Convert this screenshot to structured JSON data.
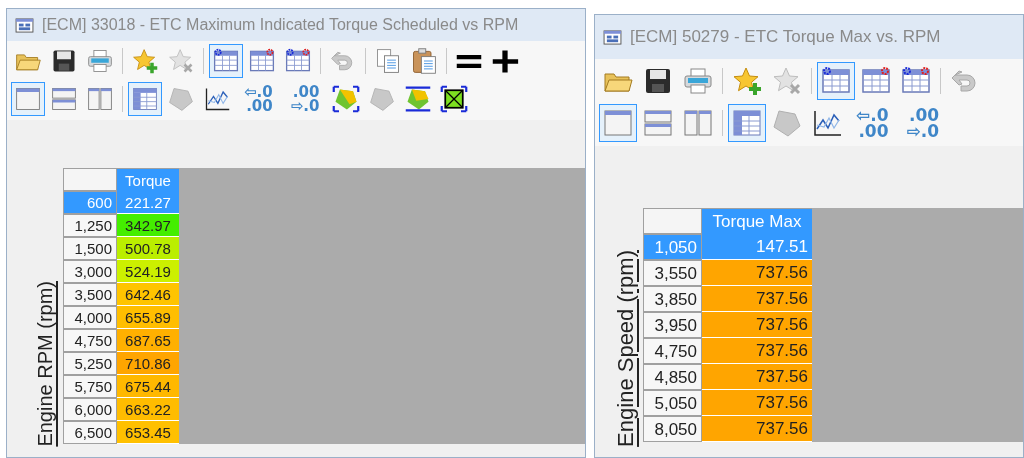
{
  "windows": [
    {
      "title": "[ECM] 33018 - ETC Maximum Indicated Torque Scheduled vs RPM",
      "toolbars": [
        [
          {
            "kind": "open",
            "selected": false
          },
          {
            "kind": "save",
            "selected": false
          },
          {
            "kind": "print",
            "selected": false
          },
          {
            "kind": "separator"
          },
          {
            "kind": "favorite-add",
            "selected": false
          },
          {
            "kind": "favorite-remove",
            "selected": false
          },
          {
            "kind": "separator"
          },
          {
            "kind": "table-x",
            "selected": true
          },
          {
            "kind": "table-y",
            "selected": false
          },
          {
            "kind": "table-xy",
            "selected": false
          },
          {
            "kind": "separator"
          },
          {
            "kind": "undo",
            "selected": false
          },
          {
            "kind": "separator"
          },
          {
            "kind": "copy",
            "selected": false
          },
          {
            "kind": "paste",
            "selected": false
          },
          {
            "kind": "separator"
          },
          {
            "kind": "equals",
            "selected": false
          },
          {
            "kind": "plus",
            "selected": false
          }
        ],
        [
          {
            "kind": "view-single",
            "selected": true
          },
          {
            "kind": "view-rows",
            "selected": false
          },
          {
            "kind": "view-columns",
            "selected": false
          },
          {
            "kind": "separator"
          },
          {
            "kind": "table-view",
            "selected": true
          },
          {
            "kind": "surface",
            "selected": false
          },
          {
            "kind": "graph",
            "selected": false
          },
          {
            "kind": "decimals",
            "lines": [
              "⇦.0",
              ".00"
            ]
          },
          {
            "kind": "decimals",
            "lines": [
              ".00",
              "⇨.0"
            ]
          },
          {
            "kind": "surface-fit",
            "selected": false
          },
          {
            "kind": "surface-side",
            "selected": false
          },
          {
            "kind": "surface-flat",
            "selected": false
          },
          {
            "kind": "surface-box",
            "selected": false
          }
        ]
      ],
      "axis_label": "Engine RPM (rpm)",
      "column_header": "Torque",
      "rows": [
        {
          "axis": "600",
          "value": "221.27",
          "selected": true,
          "color": "#3399ff"
        },
        {
          "axis": "1,250",
          "value": "342.97",
          "selected": false,
          "color": "#44ee00"
        },
        {
          "axis": "1,500",
          "value": "500.78",
          "selected": false,
          "color": "#bbee00"
        },
        {
          "axis": "3,000",
          "value": "524.19",
          "selected": false,
          "color": "#ccf000"
        },
        {
          "axis": "3,500",
          "value": "642.46",
          "selected": false,
          "color": "#ffc400"
        },
        {
          "axis": "4,000",
          "value": "655.89",
          "selected": false,
          "color": "#ffbe00"
        },
        {
          "axis": "4,750",
          "value": "687.65",
          "selected": false,
          "color": "#ffb000"
        },
        {
          "axis": "5,250",
          "value": "710.86",
          "selected": false,
          "color": "#ffa500"
        },
        {
          "axis": "5,750",
          "value": "675.44",
          "selected": false,
          "color": "#ffb800"
        },
        {
          "axis": "6,000",
          "value": "663.22",
          "selected": false,
          "color": "#ffbc00"
        },
        {
          "axis": "6,500",
          "value": "653.45",
          "selected": false,
          "color": "#ffc000"
        }
      ]
    },
    {
      "title": "[ECM] 50279 - ETC Torque Max vs. RPM",
      "toolbars": [
        [
          {
            "kind": "open",
            "selected": false
          },
          {
            "kind": "save",
            "selected": false
          },
          {
            "kind": "print",
            "selected": false
          },
          {
            "kind": "separator"
          },
          {
            "kind": "favorite-add",
            "selected": false
          },
          {
            "kind": "favorite-remove",
            "selected": false
          },
          {
            "kind": "separator"
          },
          {
            "kind": "table-x",
            "selected": true
          },
          {
            "kind": "table-y",
            "selected": false
          },
          {
            "kind": "table-xy",
            "selected": false
          },
          {
            "kind": "separator"
          },
          {
            "kind": "undo",
            "selected": false
          }
        ],
        [
          {
            "kind": "view-single",
            "selected": true
          },
          {
            "kind": "view-rows",
            "selected": false
          },
          {
            "kind": "view-columns",
            "selected": false
          },
          {
            "kind": "separator"
          },
          {
            "kind": "table-view",
            "selected": true
          },
          {
            "kind": "surface",
            "selected": false
          },
          {
            "kind": "graph",
            "selected": false
          },
          {
            "kind": "decimals",
            "lines": [
              "⇦.0",
              ".00"
            ]
          },
          {
            "kind": "decimals",
            "lines": [
              ".00",
              "⇨.0"
            ]
          }
        ]
      ],
      "axis_label": "Engine Speed (rpm)",
      "column_header": "Torque Max",
      "rows": [
        {
          "axis": "1,050",
          "value": "147.51",
          "selected": true,
          "color": "#3399ff"
        },
        {
          "axis": "3,550",
          "value": "737.56",
          "selected": false,
          "color": "#ffa500"
        },
        {
          "axis": "3,850",
          "value": "737.56",
          "selected": false,
          "color": "#ffa500"
        },
        {
          "axis": "3,950",
          "value": "737.56",
          "selected": false,
          "color": "#ffa500"
        },
        {
          "axis": "4,750",
          "value": "737.56",
          "selected": false,
          "color": "#ffa500"
        },
        {
          "axis": "4,850",
          "value": "737.56",
          "selected": false,
          "color": "#ffa500"
        },
        {
          "axis": "5,050",
          "value": "737.56",
          "selected": false,
          "color": "#ffa500"
        },
        {
          "axis": "8,050",
          "value": "737.56",
          "selected": false,
          "color": "#ffa500"
        }
      ]
    }
  ]
}
